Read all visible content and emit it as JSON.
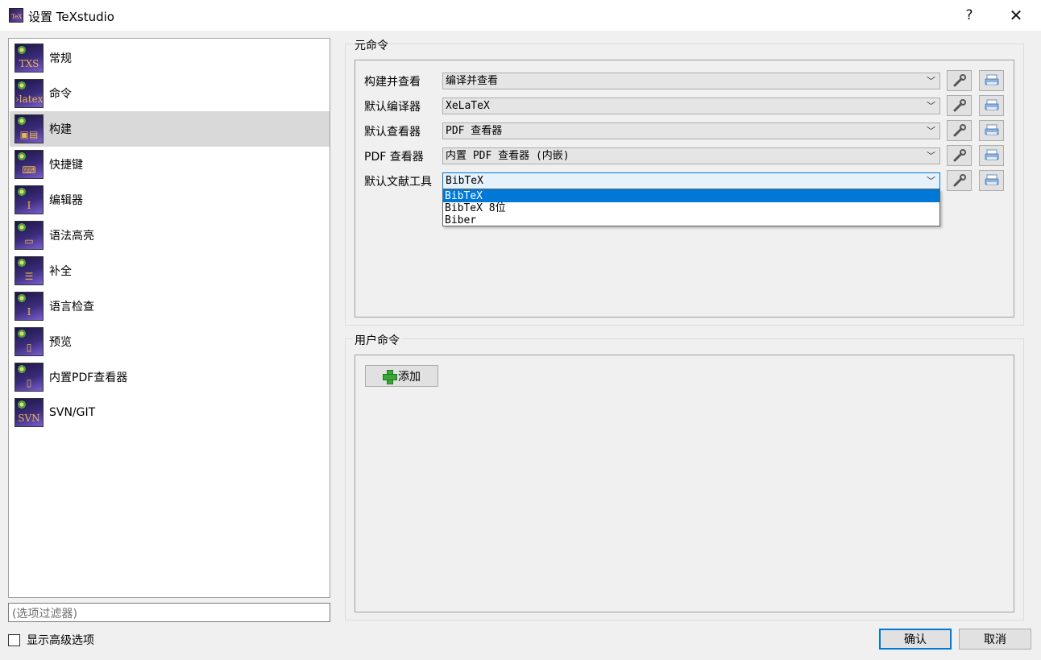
{
  "window": {
    "title": "设置 TeXstudio",
    "help": "?",
    "close": "✕"
  },
  "nav": {
    "items": [
      {
        "label": "常规",
        "icon": "txs-icon",
        "glyph": "TXS"
      },
      {
        "label": "命令",
        "icon": "latex-command-icon",
        "glyph": "›latex"
      },
      {
        "label": "构建",
        "icon": "build-icon",
        "glyph": "▣▤"
      },
      {
        "label": "快捷键",
        "icon": "keyboard-icon",
        "glyph": "⌨"
      },
      {
        "label": "编辑器",
        "icon": "editor-cursor-icon",
        "glyph": "I"
      },
      {
        "label": "语法高亮",
        "icon": "syntax-highlight-icon",
        "glyph": "▭"
      },
      {
        "label": "补全",
        "icon": "completion-icon",
        "glyph": "☰"
      },
      {
        "label": "语言检查",
        "icon": "language-check-icon",
        "glyph": "I"
      },
      {
        "label": "预览",
        "icon": "preview-icon",
        "glyph": "▯"
      },
      {
        "label": "内置PDF查看器",
        "icon": "pdf-viewer-icon",
        "glyph": "▯"
      },
      {
        "label": "SVN/GIT",
        "icon": "svn-icon",
        "glyph": "SVN"
      }
    ],
    "selected_index": 2
  },
  "filter": {
    "placeholder": "(选项过滤器)"
  },
  "advanced": {
    "label": "显示高级选项",
    "checked": false
  },
  "meta": {
    "title": "元命令",
    "rows": [
      {
        "label": "构建并查看",
        "value": "编译并查看"
      },
      {
        "label": "默认编译器",
        "value": "XeLaTeX"
      },
      {
        "label": "默认查看器",
        "value": "PDF 查看器"
      },
      {
        "label": "PDF 查看器",
        "value": "内置 PDF 查看器 (内嵌)"
      },
      {
        "label": "默认文献工具",
        "value": "BibTeX"
      }
    ],
    "dropdown_options": [
      "BibTeX",
      "BibTeX 8位",
      "Biber"
    ],
    "dropdown_selected": 0
  },
  "user": {
    "title": "用户命令",
    "add_label": "添加"
  },
  "buttons": {
    "ok": "确认",
    "cancel": "取消"
  }
}
